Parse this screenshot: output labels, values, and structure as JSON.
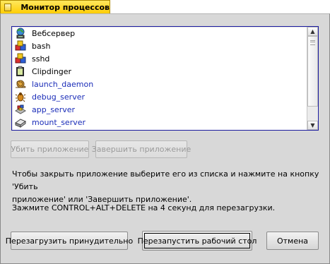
{
  "window": {
    "title": "Монитор процессов"
  },
  "process_list": [
    {
      "label": "Вебсервер",
      "icon": "webserver-globe-icon",
      "style": "black"
    },
    {
      "label": "bash",
      "icon": "app-blocks-icon",
      "style": "black"
    },
    {
      "label": "sshd",
      "icon": "app-blocks-icon",
      "style": "black"
    },
    {
      "label": "Clipdinger",
      "icon": "clipboard-icon",
      "style": "black"
    },
    {
      "label": "launch_daemon",
      "icon": "snail-icon",
      "style": "blue"
    },
    {
      "label": "debug_server",
      "icon": "bug-icon",
      "style": "blue"
    },
    {
      "label": "app_server",
      "icon": "app-server-icon",
      "style": "blue"
    },
    {
      "label": "mount_server",
      "icon": "disk-icon",
      "style": "blue"
    }
  ],
  "actions": {
    "kill": "Убить приложение",
    "quit": "Завершить приложение"
  },
  "info": {
    "line1": "Чтобы закрыть приложение выберите его из списка и нажмите на кнопку 'Убить",
    "line2": "приложение' или 'Завершить приложение'.",
    "line3": "Зажмите CONTROL+ALT+DELETE на 4 секунд для перезагрузки."
  },
  "footer": {
    "force_reboot": "Перезагрузить принудительно",
    "restart_desktop": "Перезапустить рабочий стол",
    "cancel": "Отмена"
  },
  "colors": {
    "tab": "#ffcb00",
    "window_bg": "#d8d8d8",
    "list_border": "#1b1b9f",
    "system_process_text": "#1a2cb8"
  }
}
